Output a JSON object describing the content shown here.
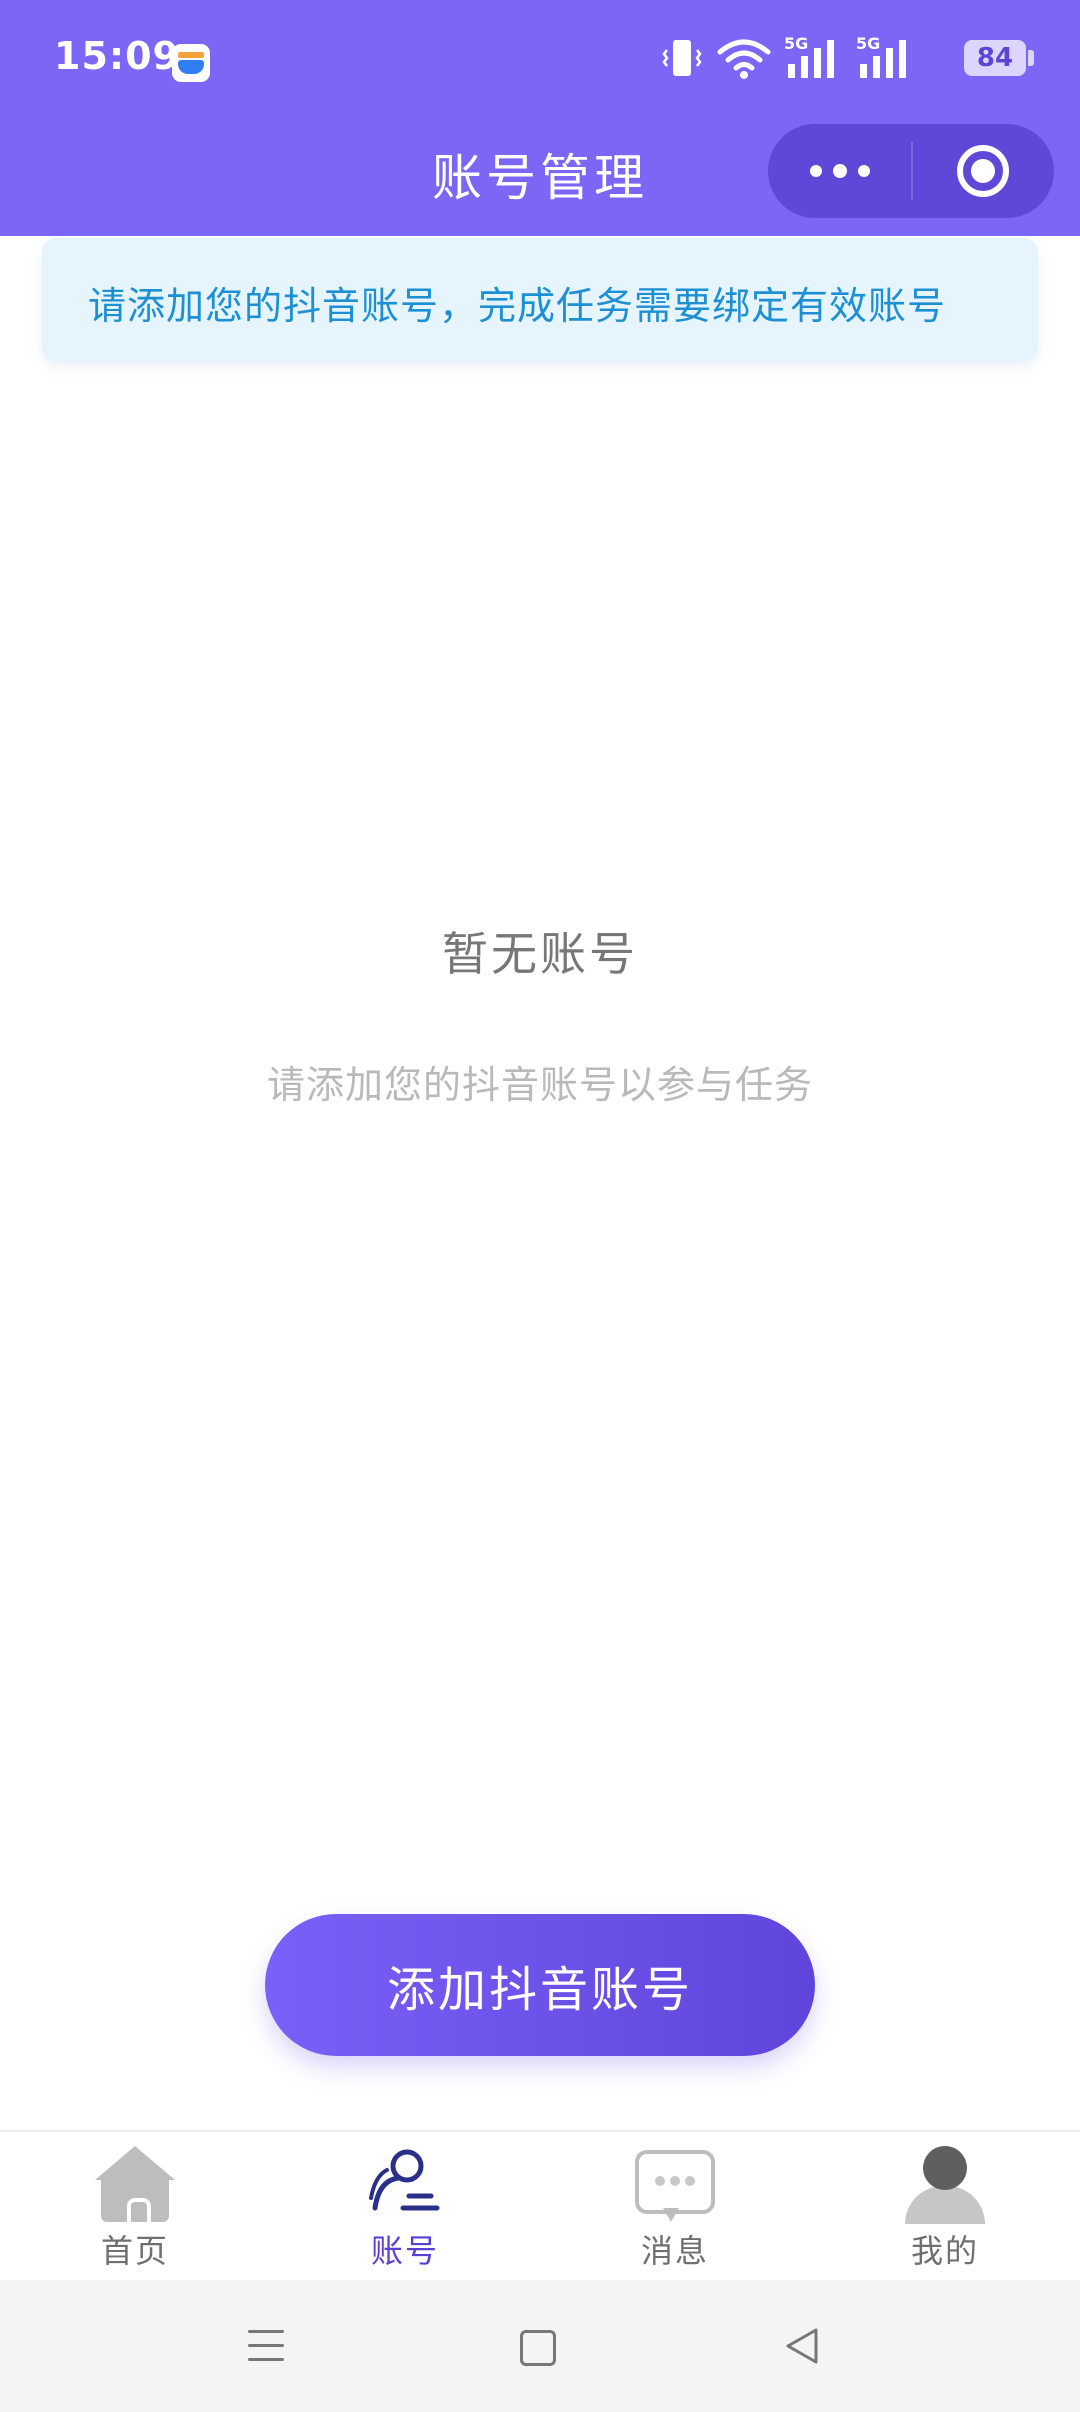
{
  "status_bar": {
    "time": "15:09",
    "network_1": "5G",
    "network_2": "5G",
    "battery": "84"
  },
  "header": {
    "title": "账号管理"
  },
  "notice": {
    "text": "请添加您的抖音账号，完成任务需要绑定有效账号"
  },
  "empty_state": {
    "title": "暂无账号",
    "subtitle": "请添加您的抖音账号以参与任务"
  },
  "add_button": {
    "label": "添加抖音账号"
  },
  "tabs": [
    {
      "label": "首页",
      "icon": "home-icon",
      "active": false
    },
    {
      "label": "账号",
      "icon": "account-icon",
      "active": true
    },
    {
      "label": "消息",
      "icon": "message-icon",
      "active": false
    },
    {
      "label": "我的",
      "icon": "profile-icon",
      "active": false
    }
  ],
  "colors": {
    "header_bg": "#7b66f6",
    "accent": "#5a3fd0",
    "notice_text": "#1d8fd3",
    "notice_bg": "#e6f4fd"
  }
}
